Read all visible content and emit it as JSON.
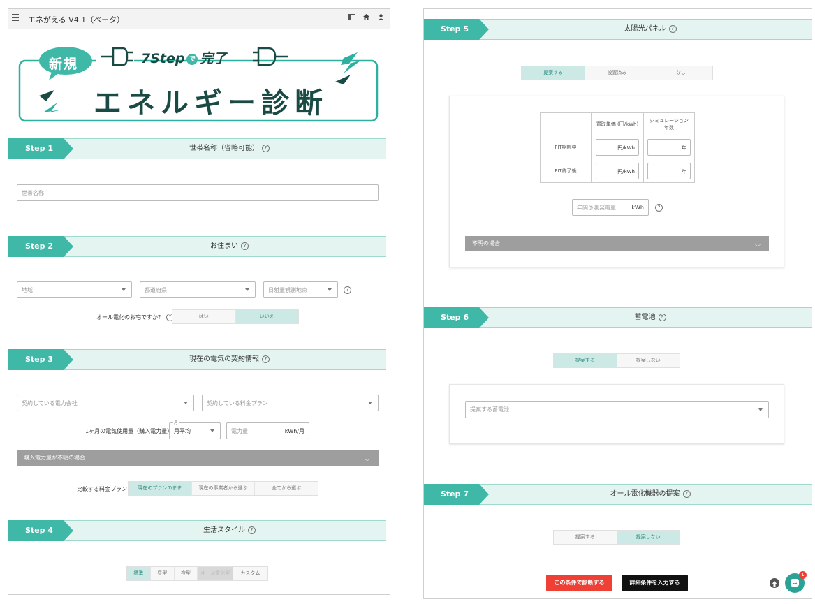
{
  "header": {
    "title": "エネがえる V4.1（ベータ）",
    "menu_icon": "hamburger-icon",
    "icons": [
      "panel-icon",
      "home-icon",
      "user-icon"
    ]
  },
  "banner": {
    "badge": "新規",
    "step_text": "7Step",
    "de": "で",
    "done": "完了",
    "main_title": "エネルギー診断",
    "accent_color": "#2db0a0",
    "dark_color": "#1a4a44"
  },
  "step1": {
    "tag": "Step 1",
    "title": "世帯名称（省略可能）",
    "household_placeholder": "世帯名称"
  },
  "step2": {
    "tag": "Step 2",
    "title": "お住まい",
    "region_placeholder": "地域",
    "prefecture_placeholder": "都道府県",
    "observation_placeholder": "日射量観測地点",
    "all_electric_label": "オール電化のお宅ですか？",
    "all_electric_options": [
      "はい",
      "いいえ"
    ],
    "all_electric_selected": "いいえ"
  },
  "step3": {
    "tag": "Step 3",
    "title": "現在の電気の契約情報",
    "company_placeholder": "契約している電力会社",
    "plan_placeholder": "契約している料金プラン",
    "usage_label": "1ヶ月の電気使用量（購入電力量）",
    "period_float_label": "月",
    "period_value": "月平均",
    "amount_placeholder": "電力量",
    "amount_unit": "kWh/月",
    "unknown_accordion": "購入電力量が不明の場合",
    "compare_label": "比較する料金プラン",
    "compare_options": [
      "現在のプランのまま",
      "現在の事業者から選ぶ",
      "全てから選ぶ"
    ],
    "compare_selected": "現在のプランのまま"
  },
  "step4": {
    "tag": "Step 4",
    "title": "生活スタイル",
    "options": [
      "標準",
      "昼型",
      "夜型",
      "オール電化型",
      "カスタム"
    ],
    "selected": "標準",
    "disabled": "オール電化型"
  },
  "step5": {
    "tag": "Step 5",
    "title": "太陽光パネル",
    "options": [
      "提案する",
      "設置済み",
      "なし"
    ],
    "selected": "提案する",
    "table": {
      "col1": "買取単価 (円/kWh)",
      "col2_line1": "シミュレーション",
      "col2_line2": "年数",
      "rows": [
        {
          "label": "FIT期間中",
          "price_unit": "円/kWh",
          "years_unit": "年"
        },
        {
          "label": "FIT終了後",
          "price_unit": "円/kWh",
          "years_unit": "年"
        }
      ]
    },
    "annual_placeholder": "年間予測発電量",
    "annual_unit": "kWh",
    "unknown_accordion": "不明の場合"
  },
  "step6": {
    "tag": "Step 6",
    "title": "蓄電池",
    "options": [
      "提案する",
      "提案しない"
    ],
    "selected": "提案する",
    "battery_placeholder": "提案する蓄電池"
  },
  "step7": {
    "tag": "Step 7",
    "title": "オール電化機器の提案",
    "options": [
      "提案する",
      "提案しない"
    ],
    "selected": "提案しない"
  },
  "footer": {
    "diagnose_button": "この条件で診断する",
    "details_button": "詳細条件を入力する",
    "chat_badge": "1",
    "red_color": "#ef4036"
  }
}
